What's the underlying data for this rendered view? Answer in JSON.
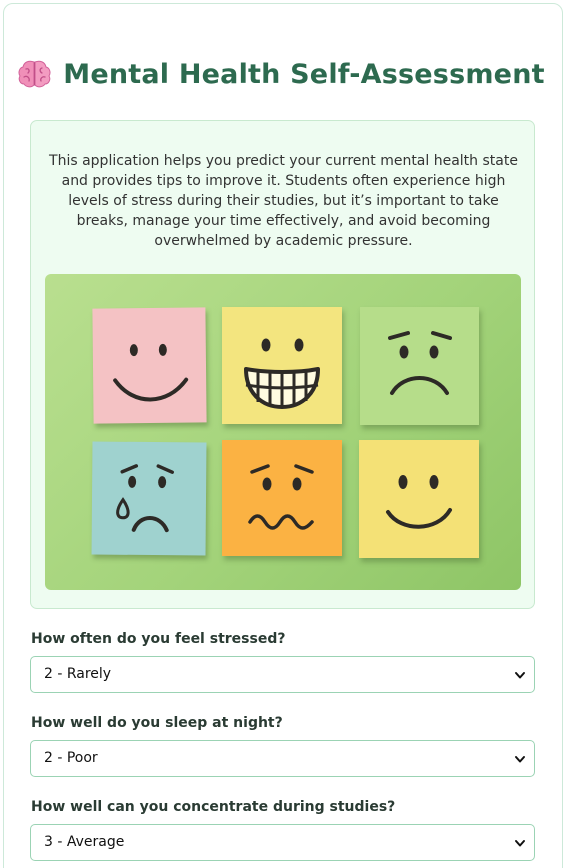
{
  "header": {
    "icon": "brain-icon",
    "title": "Mental Health Self-Assessment"
  },
  "intro": {
    "text": "This application helps you predict your current mental health state and provides tips to improve it. Students often experience high levels of stress during their studies, but it’s important to take breaks, manage your time effectively, and avoid becoming overwhelmed by academic pressure."
  },
  "hero_image": {
    "notes": [
      {
        "face": "smile-icon",
        "color": "#f4c2c4"
      },
      {
        "face": "grin-icon",
        "color": "#f3e57f"
      },
      {
        "face": "frown-icon",
        "color": "#b6dd8a"
      },
      {
        "face": "crying-icon",
        "color": "#9fd2cf"
      },
      {
        "face": "anxious-icon",
        "color": "#fbb243"
      },
      {
        "face": "smile-icon",
        "color": "#f4e176"
      }
    ]
  },
  "form": {
    "questions": [
      {
        "label": "How often do you feel stressed?",
        "value": "2 - Rarely"
      },
      {
        "label": "How well do you sleep at night?",
        "value": "2 - Poor"
      },
      {
        "label": "How well can you concentrate during studies?",
        "value": "3 - Average"
      }
    ]
  },
  "colors": {
    "title": "#2d6a4f",
    "intro_bg": "#eefcf1",
    "select_border": "#9bd3b4"
  }
}
